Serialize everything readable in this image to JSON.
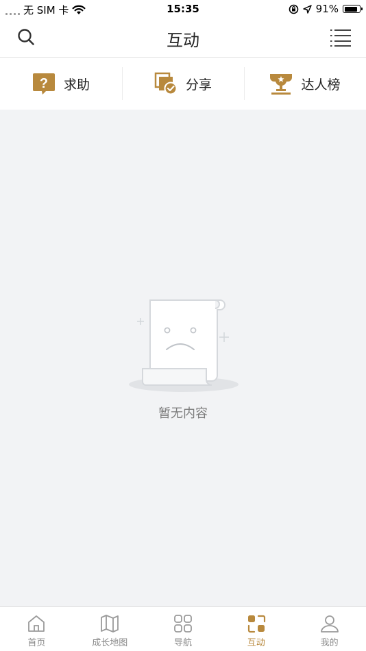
{
  "status_bar": {
    "carrier": "无 SIM 卡",
    "time": "15:35",
    "battery_percent": "91%",
    "battery_level": 0.91
  },
  "header": {
    "title": "互动",
    "search_icon": "search-icon",
    "menu_icon": "list-menu-icon"
  },
  "actions": [
    {
      "label": "求助",
      "icon": "help-question-icon"
    },
    {
      "label": "分享",
      "icon": "share-check-icon"
    },
    {
      "label": "达人榜",
      "icon": "trophy-icon"
    }
  ],
  "empty_state": {
    "text": "暂无内容",
    "icon": "sad-scroll-icon"
  },
  "tabbar": {
    "tabs": [
      {
        "label": "首页",
        "icon": "home-icon",
        "active": false
      },
      {
        "label": "成长地图",
        "icon": "map-icon",
        "active": false
      },
      {
        "label": "导航",
        "icon": "grid-icon",
        "active": false
      },
      {
        "label": "互动",
        "icon": "interact-icon",
        "active": true
      },
      {
        "label": "我的",
        "icon": "user-icon",
        "active": false
      }
    ]
  },
  "colors": {
    "accent": "#b8893d",
    "background": "#f2f3f5",
    "inactive": "#8a8a8a"
  }
}
